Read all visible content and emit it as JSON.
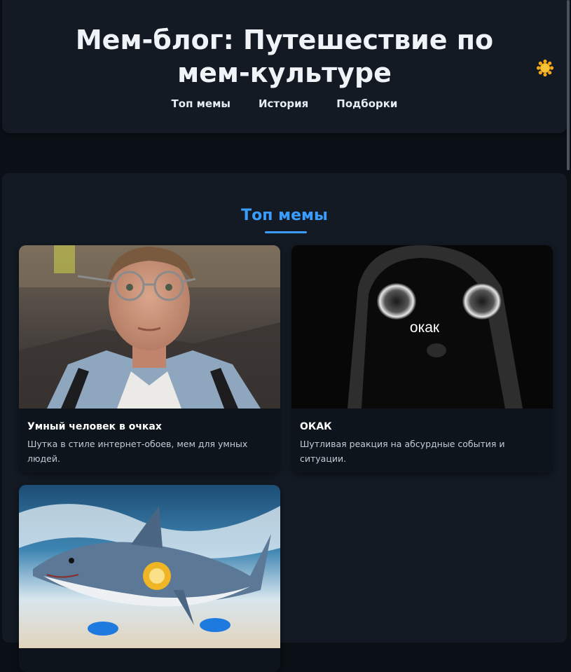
{
  "header": {
    "title": "Мем-блог: Путешествие по мем-культуре",
    "nav": [
      "Топ мемы",
      "История",
      "Подборки"
    ],
    "theme_toggle_icon": "sun-icon"
  },
  "section": {
    "title": "Топ мемы",
    "accent_color": "#3b9cff"
  },
  "cards": [
    {
      "title": "Умный человек в очках",
      "description": "Шутка в стиле интернет-обоев, мем для умных людей.",
      "image": "photo-man-in-glasses"
    },
    {
      "title": "ОКАК",
      "description": "Шутливая реакция на абсурдные события и ситуации.",
      "image": "black-cat-in-hood",
      "image_caption": "окак"
    },
    {
      "title": "",
      "description": "",
      "image": "shark-in-sneakers-on-beach"
    }
  ]
}
